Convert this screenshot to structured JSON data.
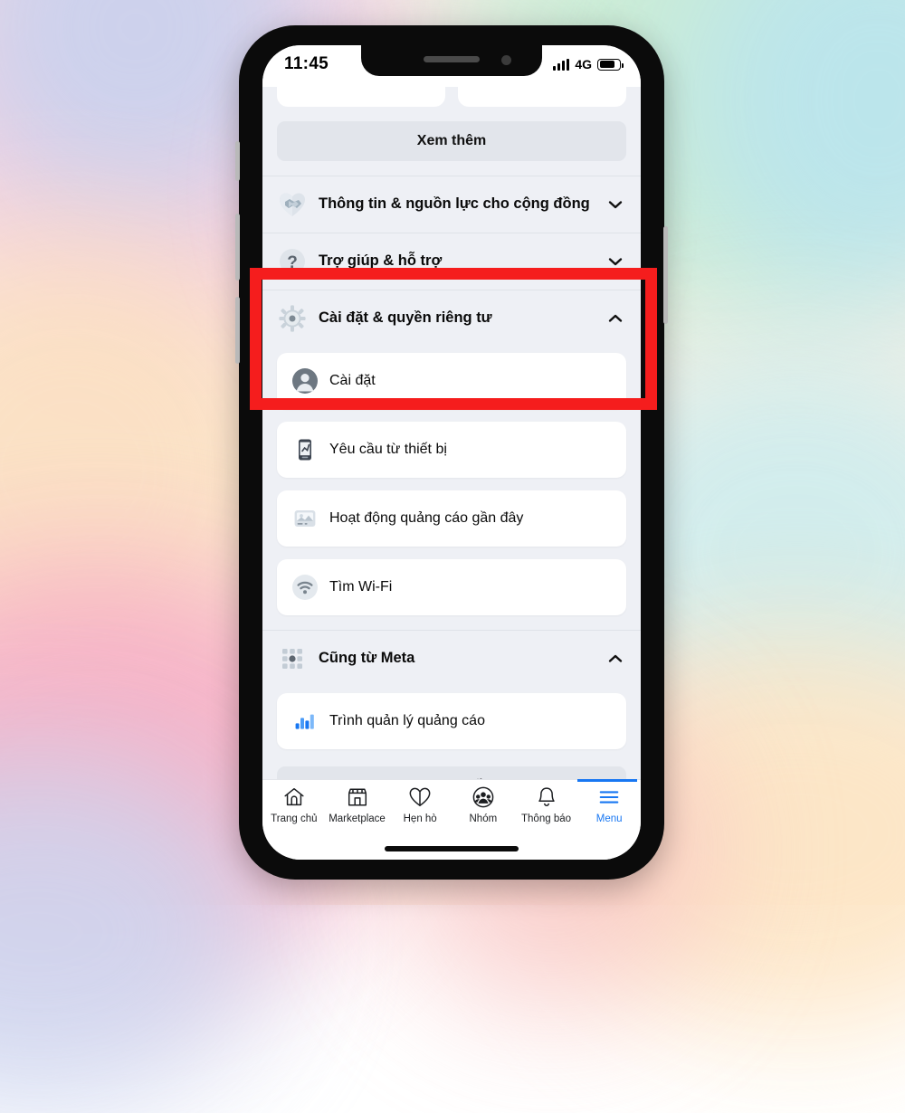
{
  "status_bar": {
    "time": "11:45",
    "network": "4G",
    "signal_icon": "cellular-signal-icon",
    "battery_icon": "battery-icon"
  },
  "content": {
    "see_more_label": "Xem thêm",
    "sections": [
      {
        "icon": "handshake-heart-icon",
        "label": "Thông tin & nguồn lực cho cộng đồng",
        "chevron": "chevron-down-icon",
        "expanded": false
      },
      {
        "icon": "question-mark-icon",
        "label": "Trợ giúp & hỗ trợ",
        "chevron": "chevron-down-icon",
        "expanded": false
      },
      {
        "icon": "gear-icon",
        "label": "Cài đặt & quyền riêng tư",
        "chevron": "chevron-up-icon",
        "expanded": true
      }
    ],
    "settings_item": {
      "icon": "avatar-icon",
      "label": "Cài đặt"
    },
    "items": [
      {
        "icon": "device-request-icon",
        "label": "Yêu cầu từ thiết bị"
      },
      {
        "icon": "recent-ad-activity-icon",
        "label": "Hoạt động quảng cáo gần đây"
      },
      {
        "icon": "wifi-icon",
        "label": "Tìm Wi-Fi"
      }
    ],
    "meta_section": {
      "icon": "meta-apps-grid-icon",
      "label": "Cũng từ Meta",
      "chevron": "chevron-up-icon",
      "items": [
        {
          "icon": "ads-manager-bar-chart-icon",
          "label": "Trình quản lý quảng cáo"
        }
      ]
    },
    "logout_label": "Đăng xuất"
  },
  "highlight": {
    "color": "#f51d1d",
    "target": "Cài đặt & quyền riêng tư"
  },
  "bottom_nav": {
    "active": "Menu",
    "accent_color": "#1877f2",
    "items": [
      {
        "icon": "home-icon",
        "label": "Trang chủ",
        "active": false
      },
      {
        "icon": "marketplace-icon",
        "label": "Marketplace",
        "active": false
      },
      {
        "icon": "dating-heart-icon",
        "label": "Hẹn hò",
        "active": false
      },
      {
        "icon": "groups-icon",
        "label": "Nhóm",
        "active": false
      },
      {
        "icon": "bell-icon",
        "label": "Thông báo",
        "active": false
      },
      {
        "icon": "hamburger-menu-icon",
        "label": "Menu",
        "active": true
      }
    ]
  }
}
